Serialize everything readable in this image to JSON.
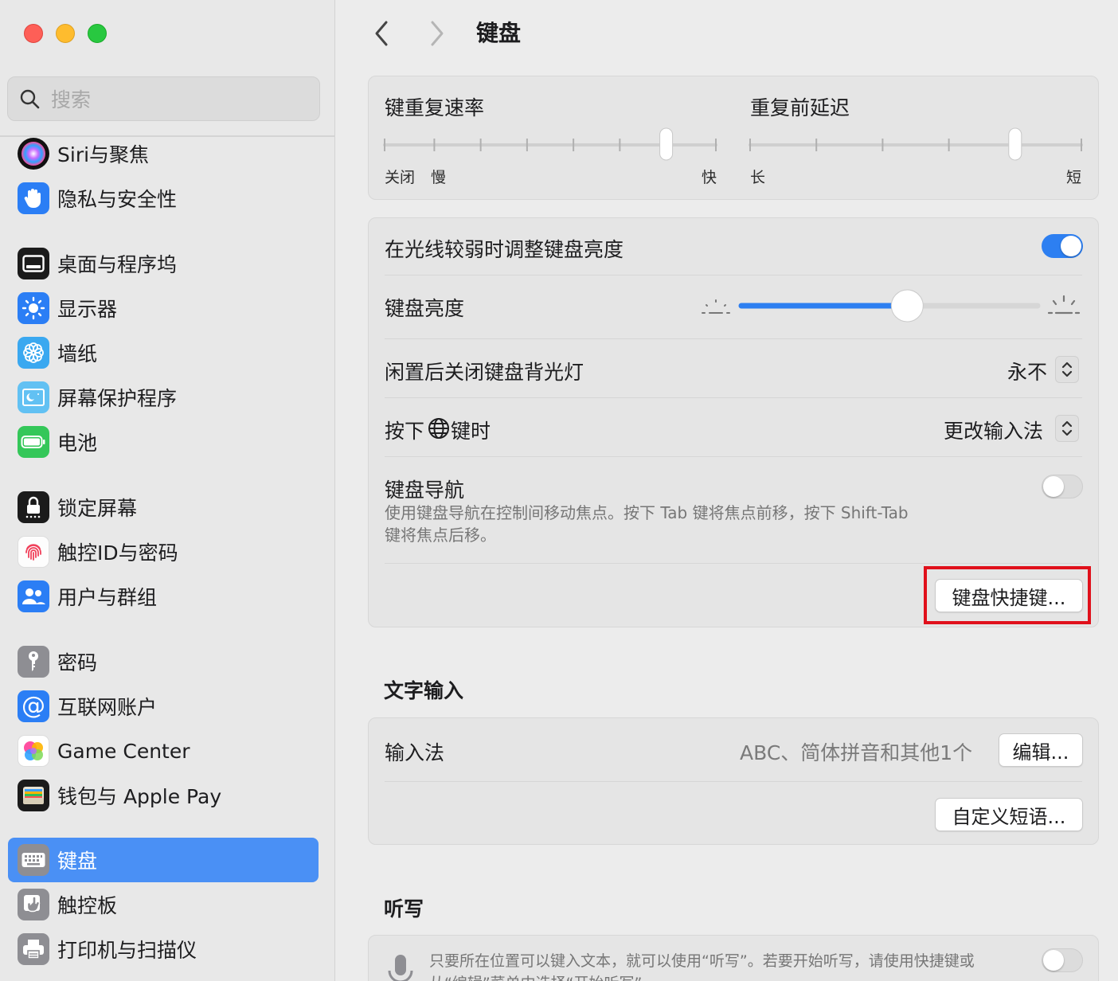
{
  "window": {
    "title": "键盘"
  },
  "sidebar": {
    "search_placeholder": "搜索",
    "items": [
      {
        "label": "Siri与聚焦",
        "icon": "siri-icon"
      },
      {
        "label": "隐私与安全性",
        "icon": "hand-icon"
      },
      {
        "label": "桌面与程序坞",
        "icon": "dock-icon"
      },
      {
        "label": "显示器",
        "icon": "sun-icon"
      },
      {
        "label": "墙纸",
        "icon": "flower-icon"
      },
      {
        "label": "屏幕保护程序",
        "icon": "screensaver-icon"
      },
      {
        "label": "电池",
        "icon": "battery-icon"
      },
      {
        "label": "锁定屏幕",
        "icon": "lock-icon"
      },
      {
        "label": "触控ID与密码",
        "icon": "fingerprint-icon"
      },
      {
        "label": "用户与群组",
        "icon": "users-icon"
      },
      {
        "label": "密码",
        "icon": "key-icon"
      },
      {
        "label": "互联网账户",
        "icon": "at-icon"
      },
      {
        "label": "Game Center",
        "icon": "game-center-icon"
      },
      {
        "label": "钱包与 Apple Pay",
        "icon": "wallet-icon"
      },
      {
        "label": "键盘",
        "icon": "keyboard-icon",
        "active": true
      },
      {
        "label": "触控板",
        "icon": "trackpad-icon"
      },
      {
        "label": "打印机与扫描仪",
        "icon": "printer-icon"
      }
    ]
  },
  "repeat": {
    "rate_title": "键重复速率",
    "delay_title": "重复前延迟",
    "rate_off": "关闭",
    "rate_slow": "慢",
    "rate_fast": "快",
    "delay_long": "长",
    "delay_short": "短",
    "rate_value": 0.85,
    "delay_value": 0.8
  },
  "backlight": {
    "auto_label": "在光线较弱时调整键盘亮度",
    "auto_on": true,
    "brightness_label": "键盘亮度",
    "brightness_value": 0.56,
    "idle_label": "闲置后关闭键盘背光灯",
    "idle_value": "永不",
    "globe_label_pre": "按下",
    "globe_label_post": "键时",
    "globe_value": "更改输入法",
    "nav_label": "键盘导航",
    "nav_desc_1": "使用键盘导航在控制间移动焦点。按下 Tab 键将焦点前移，按下 Shift-Tab",
    "nav_desc_2": "键将焦点后移。",
    "nav_on": false,
    "shortcuts_button": "键盘快捷键..."
  },
  "text_input": {
    "section_title": "文字输入",
    "input_label": "输入法",
    "input_value": "ABC、简体拼音和其他1个",
    "edit_button": "编辑...",
    "custom_button": "自定义短语..."
  },
  "dictation": {
    "section_title": "听写",
    "desc_1": "只要所在位置可以键入文本，就可以使用“听写”。若要开始听写，请使用快捷键或",
    "desc_2": "从“编辑”菜单中选择“开始听写”。",
    "on": false
  },
  "colors": {
    "accent": "#2d7ff1",
    "sidebar_active": "#4a90f5",
    "highlight": "#e0101b"
  }
}
